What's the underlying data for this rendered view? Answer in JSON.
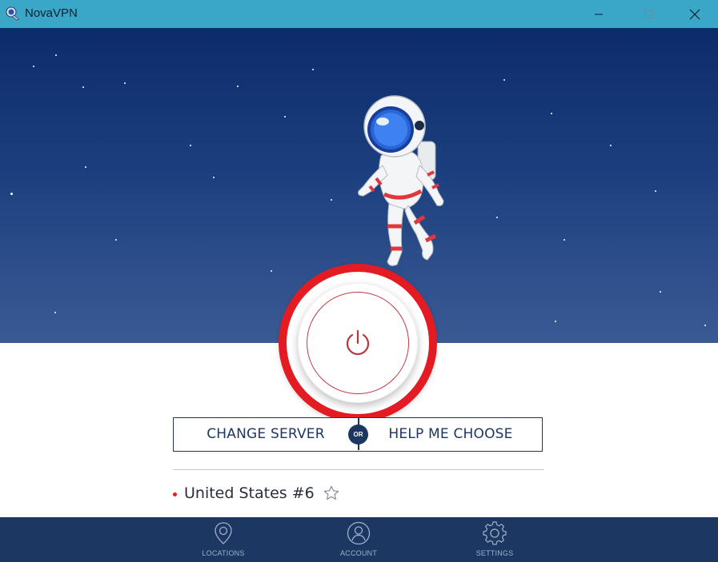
{
  "window": {
    "title": "NovaVPN",
    "controls": {
      "minimize": "minimize-icon",
      "maximize": "maximize-icon",
      "close": "close-icon"
    }
  },
  "main": {
    "power_button_icon": "power-icon",
    "change_server_label": "CHANGE SERVER",
    "or_label": "OR",
    "help_choose_label": "HELP ME CHOOSE",
    "server": {
      "name": "United States #6",
      "favorite_icon": "star-outline-icon"
    }
  },
  "nav": {
    "items": [
      {
        "label": "LOCATIONS",
        "icon": "location-pin-icon"
      },
      {
        "label": "ACCOUNT",
        "icon": "user-icon"
      },
      {
        "label": "SETTINGS",
        "icon": "gear-icon"
      }
    ]
  },
  "colors": {
    "titlebar": "#3aa6c8",
    "sky_top": "#0d2b6b",
    "sky_bottom": "#3a5a94",
    "accent_red": "#e31b23",
    "navy": "#1c3762"
  }
}
